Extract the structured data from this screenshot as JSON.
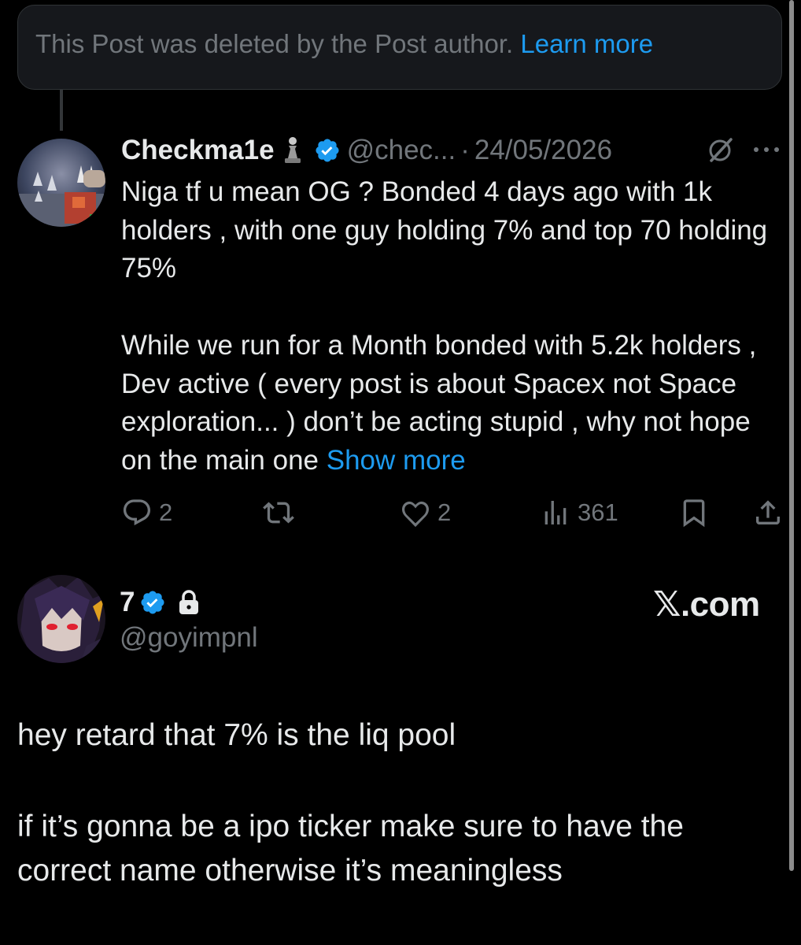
{
  "deleted_notice": {
    "text": "This Post was deleted by the Post author.",
    "link": "Learn more"
  },
  "reply": {
    "display_name": "Checkma1e",
    "handle": "@chec...",
    "separator": "·",
    "date": "24/05/2026",
    "icons": [
      "chess-pawn-icon",
      "verified-badge-icon",
      "grok-icon",
      "more-icon"
    ],
    "text_paragraphs": [
      "Niga tf u mean OG ? Bonded 4 days ago with 1k holders , with one guy holding 7% and top 70 holding 75%",
      "While we run for a Month bonded with 5.2k holders  , Dev active ( every post is about Spacex not Space exploration... ) don’t be acting stupid , why not hope on the main one"
    ],
    "show_more": "Show more",
    "actions": {
      "replies": "2",
      "reposts": "",
      "likes": "2",
      "views": "361"
    }
  },
  "main_post": {
    "display_name": "7",
    "handle": "@goyimpnl",
    "icons": [
      "verified-badge-icon",
      "lock-icon"
    ],
    "watermark": "𝕏.com",
    "text_paragraphs": [
      "hey retard that 7% is the liq pool",
      "if it’s gonna be a ipo ticker make sure to have the correct name otherwise it’s meaningless"
    ]
  },
  "colors": {
    "background": "#000000",
    "text": "#e7e9ea",
    "muted": "#71767b",
    "accent": "#1d9bf0",
    "border": "#2f3336"
  }
}
